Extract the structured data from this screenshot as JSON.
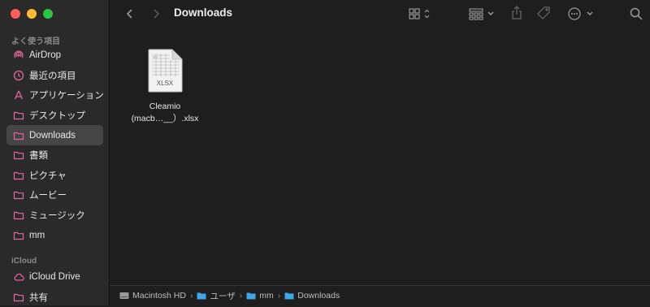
{
  "window": {
    "title": "Downloads"
  },
  "sidebar": {
    "section1_label": "よく使う項目",
    "items": [
      {
        "label": "AirDrop",
        "icon": "airdrop-icon"
      },
      {
        "label": "最近の項目",
        "icon": "clock-icon"
      },
      {
        "label": "アプリケーション",
        "icon": "applications-icon"
      },
      {
        "label": "デスクトップ",
        "icon": "folder-icon"
      },
      {
        "label": "Downloads",
        "icon": "folder-icon",
        "selected": true
      },
      {
        "label": "書類",
        "icon": "folder-icon"
      },
      {
        "label": "ピクチャ",
        "icon": "folder-icon"
      },
      {
        "label": "ムービー",
        "icon": "folder-icon"
      },
      {
        "label": "ミュージック",
        "icon": "folder-icon"
      },
      {
        "label": "mm",
        "icon": "folder-icon"
      }
    ],
    "section2_label": "iCloud",
    "icloud_items": [
      {
        "label": "iCloud Drive",
        "icon": "cloud-icon"
      },
      {
        "label": "共有",
        "icon": "shared-folder-icon"
      }
    ]
  },
  "files": [
    {
      "name_line1": "Cleamio",
      "name_line2": "(macb…__）.xlsx",
      "badge": "XLSX"
    }
  ],
  "pathbar": {
    "items": [
      "Macintosh HD",
      "ユーザ",
      "mm",
      "Downloads"
    ]
  },
  "colors": {
    "sidebar_accent": "#e2669c",
    "folder_blue": "#3da7e8"
  }
}
